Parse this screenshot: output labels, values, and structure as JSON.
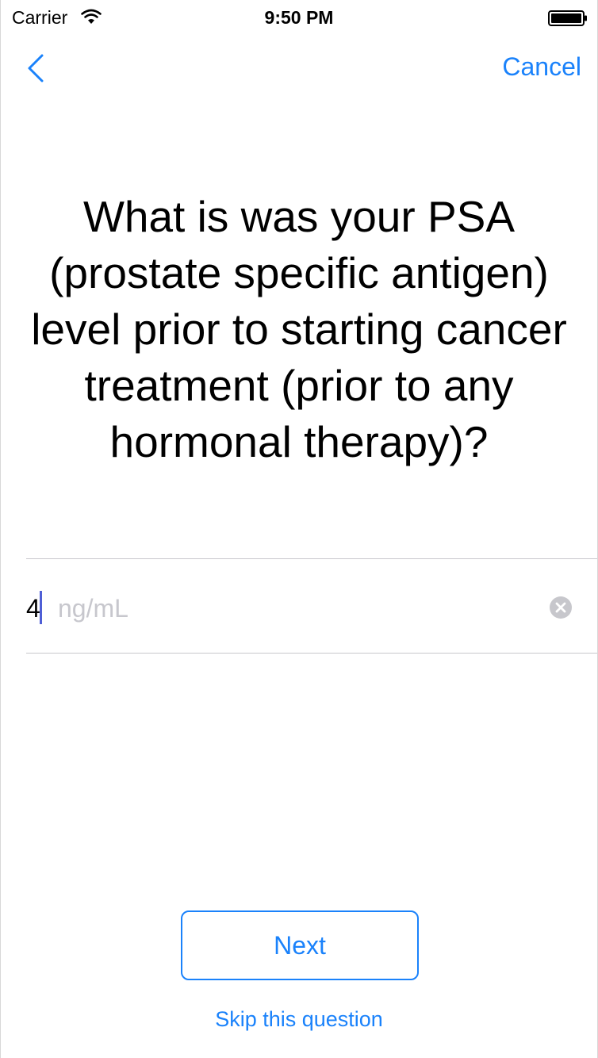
{
  "status_bar": {
    "carrier": "Carrier",
    "time": "9:50 PM",
    "icons": [
      "wifi-icon",
      "battery-icon"
    ]
  },
  "nav": {
    "back_icon": "chevron-left-icon",
    "cancel_label": "Cancel"
  },
  "question": {
    "text": "What is was your PSA (prostate specific antigen) level prior to starting cancer treatment (prior to any hormonal therapy)?"
  },
  "answer": {
    "value": "4",
    "unit_placeholder": "ng/mL",
    "clear_icon": "clear-circle-icon"
  },
  "actions": {
    "next_label": "Next",
    "skip_label": "Skip this question"
  },
  "colors": {
    "accent": "#1a82fb",
    "placeholder": "#c7c7cd",
    "separator": "#c8c7cc",
    "caret": "#4f5fd6"
  }
}
